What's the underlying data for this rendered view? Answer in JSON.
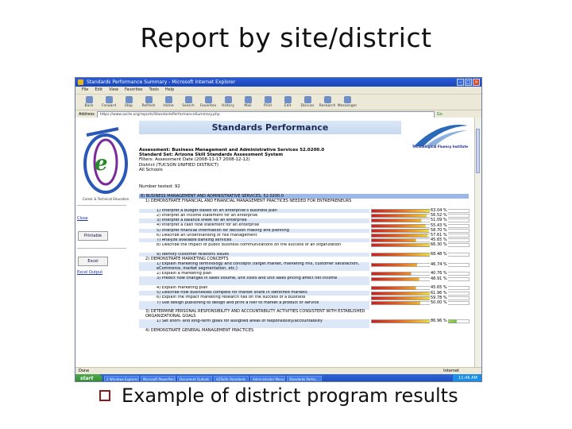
{
  "slide": {
    "title": "Report by site/district",
    "bullet": "Example of district program results",
    "accent_color": "#8b1a1a"
  },
  "browser": {
    "window_title": "Standards Performance Summary - Microsoft Internet Explorer",
    "menu": [
      "File",
      "Edit",
      "View",
      "Favorites",
      "Tools",
      "Help"
    ],
    "toolbar": [
      "Back",
      "Forward",
      "Stop",
      "Refresh",
      "Home",
      "Search",
      "Favorites",
      "History",
      "Mail",
      "Print",
      "Edit",
      "Discuss",
      "Research",
      "Messenger"
    ],
    "address_label": "Address",
    "address": "https://www.azcte.org/reports/StandardsPerformanceSummary.php",
    "go_label": "Go",
    "status_left": "Done",
    "status_right": "Internet",
    "start_label": "start",
    "tasks": [
      "2 Windows Explorer",
      "Microsoft PowerPoint",
      "Document Outlook",
      "AZSkills Standards",
      "Administrator Menu",
      "Standards Perfor..."
    ],
    "clock": "11:46 AM"
  },
  "page": {
    "banner": "Standards Performance",
    "logo_caption": "Career & Technical Education",
    "tfi_caption": "Technological Fluency Institute",
    "side_links": {
      "close": "Close",
      "printable": "Printable",
      "excel": "Excel",
      "excel_output": "Excel Output"
    },
    "assessment": "Assessment: Business Management and Administrative Services 52.0200.0",
    "standard_set": "Standard Set: Arizona Skill Standards Assessment System",
    "date_line": "Filters: Assessment Date (2008-11-17 2008-12-12)",
    "district_line": "District (TUCSON UNIFIED DISTRICT)",
    "schools_line": "All Schools",
    "number_tested": "Number tested: 92",
    "section": "8) BUSINESS MANAGEMENT AND ADMINISTRATIVE SERVICES, 52.0200.0",
    "categories": [
      {
        "title": "1) DEMONSTRATE FINANCIAL AND FINANCIAL MANAGEMENT PRACTICES NEEDED FOR ENTREPRENEURS",
        "items": [
          {
            "label": "1) Interpret a budget based on an enterprise's business plan",
            "pct": "63.04 %",
            "score": 63.04
          },
          {
            "label": "2) Interpret an income statement for an enterprise",
            "pct": "56.52 %",
            "score": 56.52
          },
          {
            "label": "3) Interpret a balance sheet for an enterprise",
            "pct": "51.09 %",
            "score": 51.09
          },
          {
            "label": "4) Interpret a cash flow statement for an enterprise",
            "pct": "55.43 %",
            "score": 55.43
          },
          {
            "label": "5) Interpret financial information for decision making and planning",
            "pct": "58.70 %",
            "score": 58.7
          },
          {
            "label": "6) Describe an understanding of risk management",
            "pct": "57.61 %",
            "score": 57.61
          },
          {
            "label": "7) Analyze available banking services",
            "pct": "45.65 %",
            "score": 45.65
          },
          {
            "label": "8) Describe the impact of public business communications on the success of an organization",
            "pct": "66.30 %",
            "score": 66.3
          },
          {
            "label": "9) Identify customer relations issues",
            "pct": "68.48 %",
            "score": 68.48
          }
        ]
      },
      {
        "title": "2) DEMONSTRATE MARKETING CONCEPTS",
        "items": [
          {
            "label": "1) Explain marketing terminology and concepts (target market, marketing mix, customer satisfaction, eCommerce, market segmentation, etc.)",
            "pct": "46.74 %",
            "score": 46.74
          },
          {
            "label": "2) Explain a marketing plan",
            "pct": "40.76 %",
            "score": 40.76
          },
          {
            "label": "3) Predict how changes in sales volume, unit costs and unit sales pricing affect net income",
            "pct": "48.91 %",
            "score": 48.91
          },
          {
            "label": "4) Explain marketing plan",
            "pct": "45.65 %",
            "score": 45.65
          },
          {
            "label": "5) Describe how businesses compete for market share in identified markets",
            "pct": "61.96 %",
            "score": 61.96
          },
          {
            "label": "6) Explain the impact marketing research has on the success of a business",
            "pct": "59.78 %",
            "score": 59.78
          },
          {
            "label": "7) Use design publishing to design and print a flier to market a product or service",
            "pct": "50.00 %",
            "score": 50.0
          }
        ]
      },
      {
        "title": "3) DETERMINE PERSONAL RESPONSIBILITY AND ACCOUNTABILITY ACTIVITIES CONSISTENT WITH ESTABLISHED ORGANIZATIONAL GOALS",
        "items": [
          {
            "label": "1) Set short- and long-term goals for assigned areas of responsibility/accountability",
            "pct": "86.96 %",
            "score": 86.96
          }
        ]
      },
      {
        "title": "4) DEMONSTRATE GENERAL MANAGEMENT PRACTICES",
        "items": []
      }
    ]
  }
}
